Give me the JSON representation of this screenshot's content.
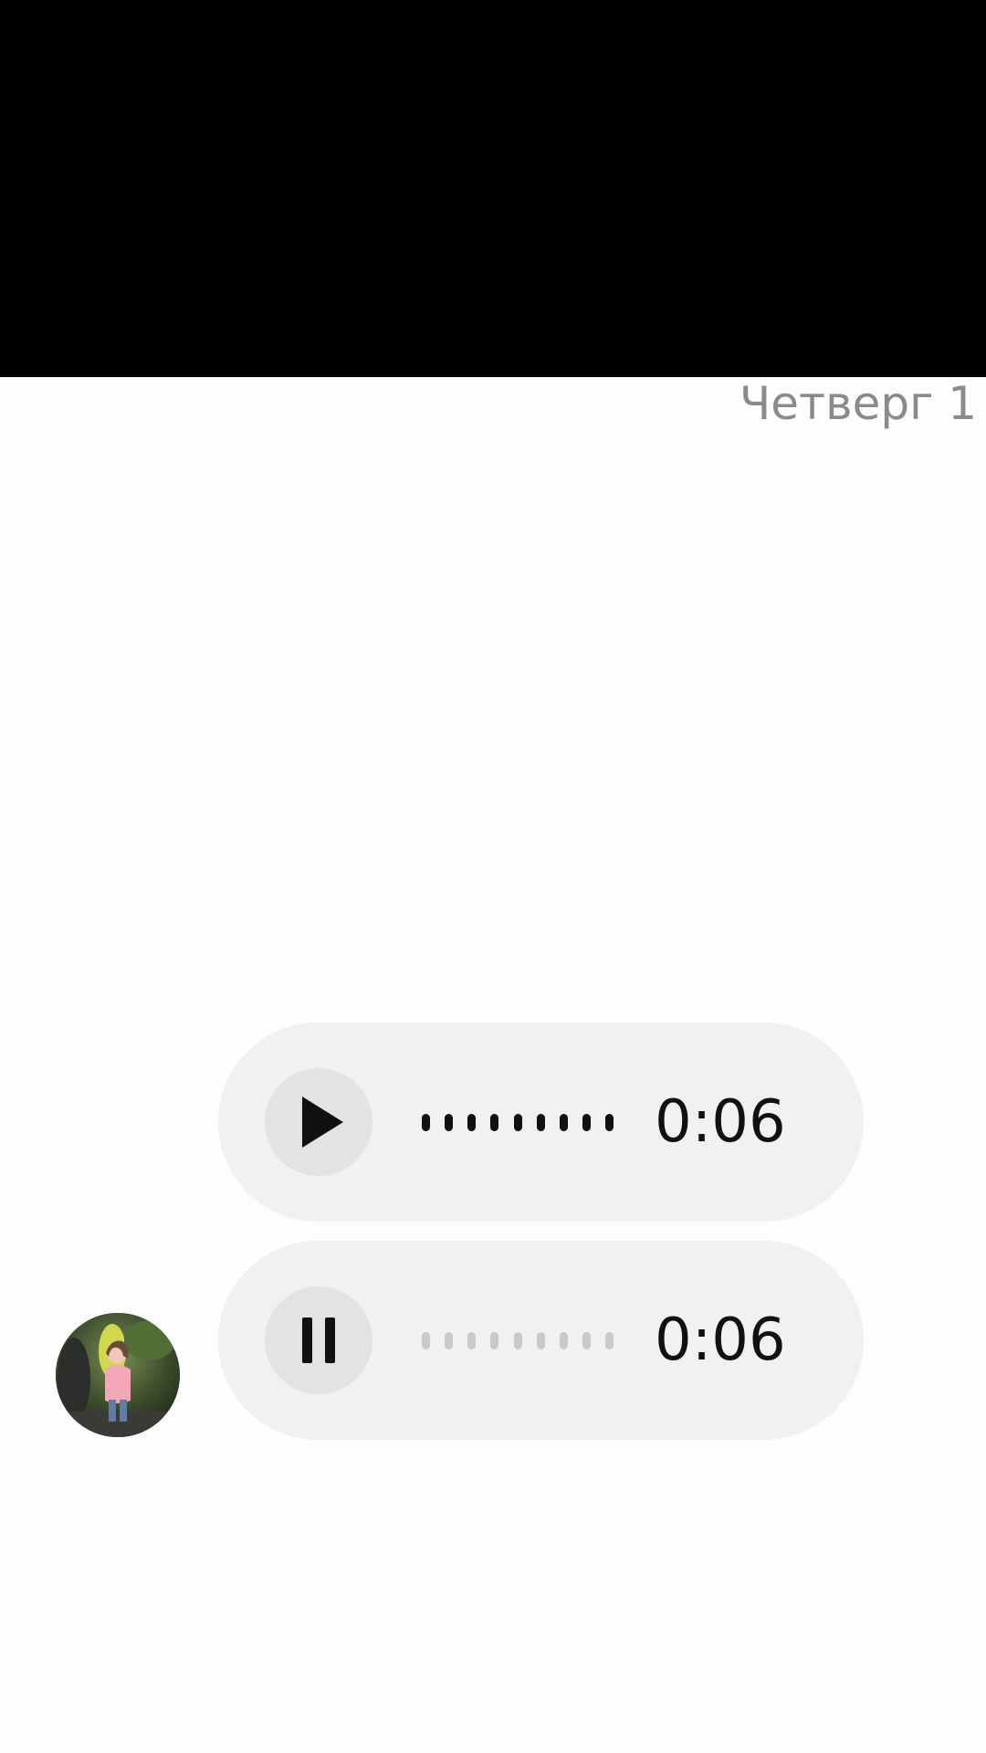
{
  "conversation": {
    "date_label": "Четверг 1",
    "messages": [
      {
        "type": "voice",
        "state": "paused",
        "control_icon": "play-icon",
        "duration": "0:06"
      },
      {
        "type": "voice",
        "state": "playing",
        "control_icon": "pause-icon",
        "duration": "0:06",
        "sender_avatar": "avatar"
      }
    ]
  },
  "colors": {
    "top_bar": "#000000",
    "background": "#fdfdfd",
    "bubble": "#f1f1f1",
    "control_circle": "#e3e3e3",
    "waveform_active": "#111111",
    "waveform_muted": "#c9c9c9",
    "date_text": "#8a8a8a"
  }
}
